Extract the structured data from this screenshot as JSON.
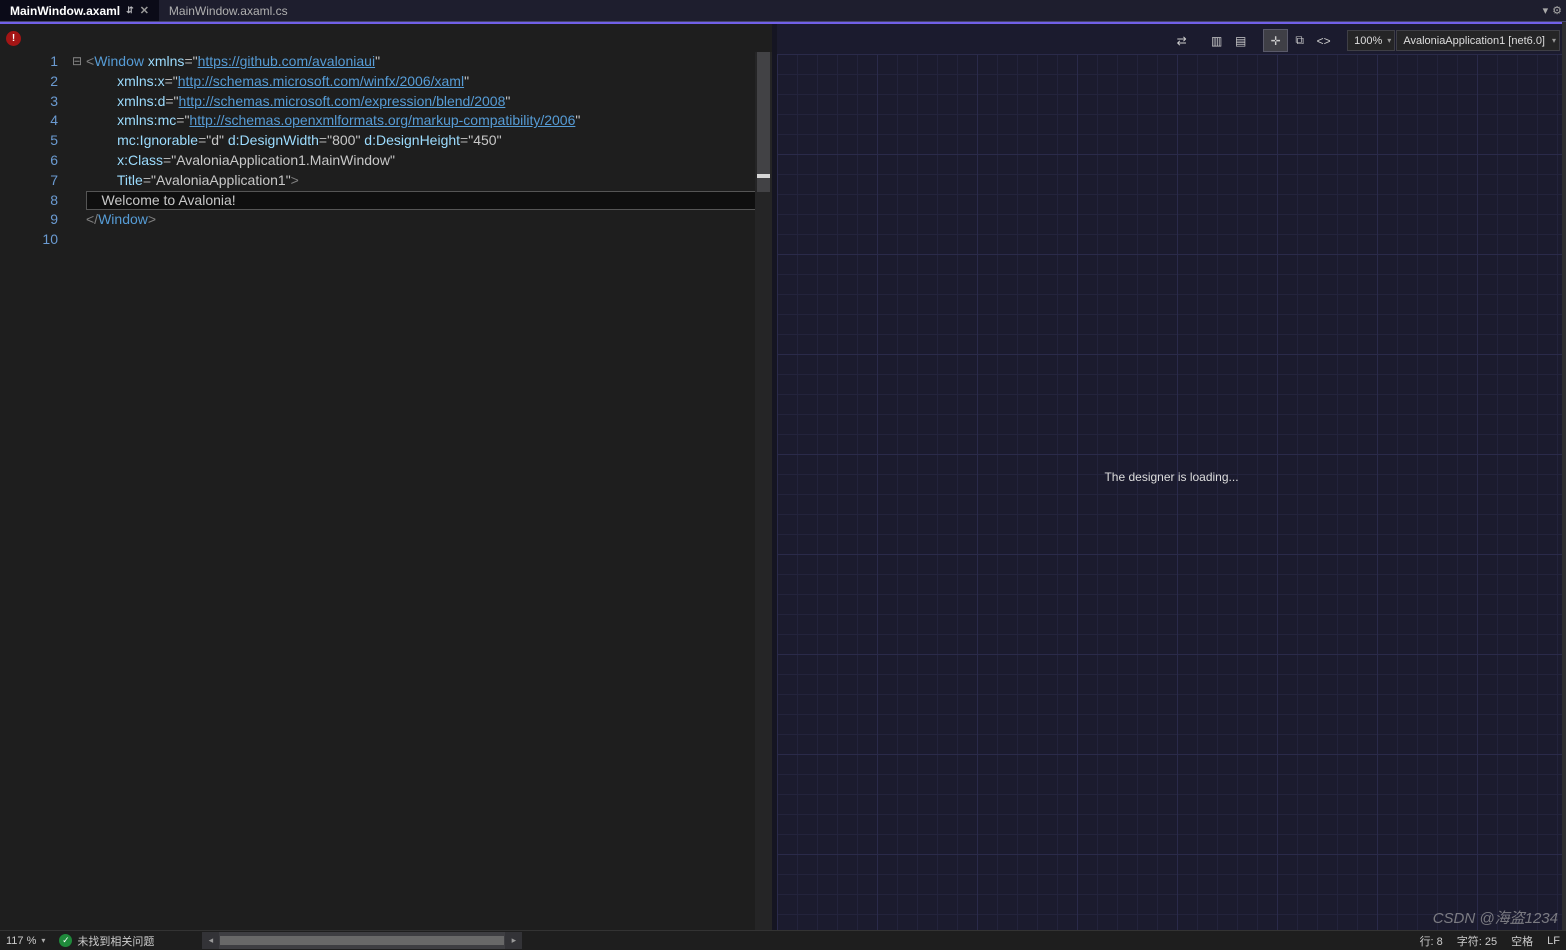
{
  "tabs": [
    {
      "label": "MainWindow.axaml",
      "active": true,
      "pinned": true
    },
    {
      "label": "MainWindow.axaml.cs",
      "active": false,
      "pinned": false
    }
  ],
  "toolbar": {
    "zoom": "100%",
    "config": "AvaloniaApplication1 [net6.0]"
  },
  "designer": {
    "message": "The designer is loading..."
  },
  "code": {
    "lines": [
      {
        "n": 1,
        "fold": "⊟",
        "segs": [
          [
            "br",
            "<"
          ],
          [
            "el",
            "Window"
          ],
          [
            "",
            ""
          ],
          [
            "at",
            " xmlns"
          ],
          [
            "op",
            "="
          ],
          [
            "str",
            "\""
          ],
          [
            "url",
            "https://github.com/avaloniaui"
          ],
          [
            "str",
            "\""
          ]
        ]
      },
      {
        "n": 2,
        "segs": [
          [
            "",
            "        "
          ],
          [
            "at",
            "xmlns:x"
          ],
          [
            "op",
            "="
          ],
          [
            "str",
            "\""
          ],
          [
            "url",
            "http://schemas.microsoft.com/winfx/2006/xaml"
          ],
          [
            "str",
            "\""
          ]
        ]
      },
      {
        "n": 3,
        "segs": [
          [
            "",
            "        "
          ],
          [
            "at",
            "xmlns:d"
          ],
          [
            "op",
            "="
          ],
          [
            "str",
            "\""
          ],
          [
            "url",
            "http://schemas.microsoft.com/expression/blend/2008"
          ],
          [
            "str",
            "\""
          ]
        ]
      },
      {
        "n": 4,
        "segs": [
          [
            "",
            "        "
          ],
          [
            "at",
            "xmlns:mc"
          ],
          [
            "op",
            "="
          ],
          [
            "str",
            "\""
          ],
          [
            "url",
            "http://schemas.openxmlformats.org/markup-compatibility/2006"
          ],
          [
            "str",
            "\""
          ]
        ]
      },
      {
        "n": 5,
        "segs": [
          [
            "",
            "        "
          ],
          [
            "at",
            "mc:Ignorable"
          ],
          [
            "op",
            "="
          ],
          [
            "str",
            "\"d\""
          ],
          [
            "",
            ""
          ],
          [
            "at",
            " d:DesignWidth"
          ],
          [
            "op",
            "="
          ],
          [
            "str",
            "\"800\""
          ],
          [
            "at",
            " d:DesignHeight"
          ],
          [
            "op",
            "="
          ],
          [
            "str",
            "\"450\""
          ]
        ]
      },
      {
        "n": 6,
        "segs": [
          [
            "",
            "        "
          ],
          [
            "at",
            "x:Class"
          ],
          [
            "op",
            "="
          ],
          [
            "str",
            "\"AvaloniaApplication1.MainWindow\""
          ]
        ]
      },
      {
        "n": 7,
        "segs": [
          [
            "",
            "        "
          ],
          [
            "at",
            "Title"
          ],
          [
            "op",
            "="
          ],
          [
            "str",
            "\"AvaloniaApplication1\""
          ],
          [
            "br",
            ">"
          ]
        ]
      },
      {
        "n": 8,
        "hl": true,
        "segs": [
          [
            "txt",
            "    Welcome to Avalonia!"
          ]
        ]
      },
      {
        "n": 9,
        "segs": [
          [
            "br",
            "</"
          ],
          [
            "el",
            "Window"
          ],
          [
            "br",
            ">"
          ]
        ]
      },
      {
        "n": 10,
        "segs": [
          [
            "",
            ""
          ]
        ]
      }
    ]
  },
  "status": {
    "zoom": "117 %",
    "issues": "未找到相关问题",
    "line": "行: 8",
    "char": "字符: 25",
    "indent": "空格",
    "lineEnding": "LF"
  },
  "watermark": "CSDN @海盗1234"
}
